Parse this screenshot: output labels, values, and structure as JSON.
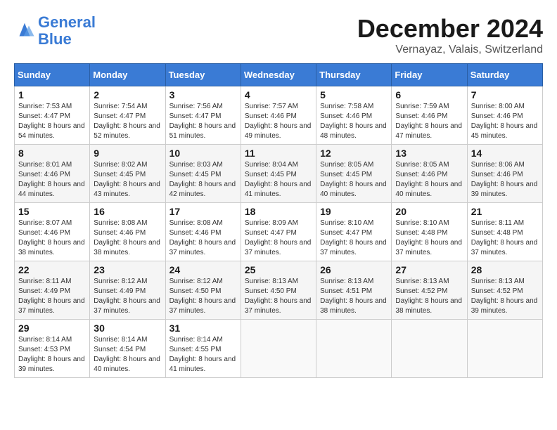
{
  "header": {
    "logo_line1": "General",
    "logo_line2": "Blue",
    "title": "December 2024",
    "subtitle": "Vernayaz, Valais, Switzerland"
  },
  "days_of_week": [
    "Sunday",
    "Monday",
    "Tuesday",
    "Wednesday",
    "Thursday",
    "Friday",
    "Saturday"
  ],
  "weeks": [
    [
      {
        "day": "1",
        "sunrise": "7:53 AM",
        "sunset": "4:47 PM",
        "daylight": "8 hours and 54 minutes."
      },
      {
        "day": "2",
        "sunrise": "7:54 AM",
        "sunset": "4:47 PM",
        "daylight": "8 hours and 52 minutes."
      },
      {
        "day": "3",
        "sunrise": "7:56 AM",
        "sunset": "4:47 PM",
        "daylight": "8 hours and 51 minutes."
      },
      {
        "day": "4",
        "sunrise": "7:57 AM",
        "sunset": "4:46 PM",
        "daylight": "8 hours and 49 minutes."
      },
      {
        "day": "5",
        "sunrise": "7:58 AM",
        "sunset": "4:46 PM",
        "daylight": "8 hours and 48 minutes."
      },
      {
        "day": "6",
        "sunrise": "7:59 AM",
        "sunset": "4:46 PM",
        "daylight": "8 hours and 47 minutes."
      },
      {
        "day": "7",
        "sunrise": "8:00 AM",
        "sunset": "4:46 PM",
        "daylight": "8 hours and 45 minutes."
      }
    ],
    [
      {
        "day": "8",
        "sunrise": "8:01 AM",
        "sunset": "4:46 PM",
        "daylight": "8 hours and 44 minutes."
      },
      {
        "day": "9",
        "sunrise": "8:02 AM",
        "sunset": "4:45 PM",
        "daylight": "8 hours and 43 minutes."
      },
      {
        "day": "10",
        "sunrise": "8:03 AM",
        "sunset": "4:45 PM",
        "daylight": "8 hours and 42 minutes."
      },
      {
        "day": "11",
        "sunrise": "8:04 AM",
        "sunset": "4:45 PM",
        "daylight": "8 hours and 41 minutes."
      },
      {
        "day": "12",
        "sunrise": "8:05 AM",
        "sunset": "4:45 PM",
        "daylight": "8 hours and 40 minutes."
      },
      {
        "day": "13",
        "sunrise": "8:05 AM",
        "sunset": "4:46 PM",
        "daylight": "8 hours and 40 minutes."
      },
      {
        "day": "14",
        "sunrise": "8:06 AM",
        "sunset": "4:46 PM",
        "daylight": "8 hours and 39 minutes."
      }
    ],
    [
      {
        "day": "15",
        "sunrise": "8:07 AM",
        "sunset": "4:46 PM",
        "daylight": "8 hours and 38 minutes."
      },
      {
        "day": "16",
        "sunrise": "8:08 AM",
        "sunset": "4:46 PM",
        "daylight": "8 hours and 38 minutes."
      },
      {
        "day": "17",
        "sunrise": "8:08 AM",
        "sunset": "4:46 PM",
        "daylight": "8 hours and 37 minutes."
      },
      {
        "day": "18",
        "sunrise": "8:09 AM",
        "sunset": "4:47 PM",
        "daylight": "8 hours and 37 minutes."
      },
      {
        "day": "19",
        "sunrise": "8:10 AM",
        "sunset": "4:47 PM",
        "daylight": "8 hours and 37 minutes."
      },
      {
        "day": "20",
        "sunrise": "8:10 AM",
        "sunset": "4:48 PM",
        "daylight": "8 hours and 37 minutes."
      },
      {
        "day": "21",
        "sunrise": "8:11 AM",
        "sunset": "4:48 PM",
        "daylight": "8 hours and 37 minutes."
      }
    ],
    [
      {
        "day": "22",
        "sunrise": "8:11 AM",
        "sunset": "4:49 PM",
        "daylight": "8 hours and 37 minutes."
      },
      {
        "day": "23",
        "sunrise": "8:12 AM",
        "sunset": "4:49 PM",
        "daylight": "8 hours and 37 minutes."
      },
      {
        "day": "24",
        "sunrise": "8:12 AM",
        "sunset": "4:50 PM",
        "daylight": "8 hours and 37 minutes."
      },
      {
        "day": "25",
        "sunrise": "8:13 AM",
        "sunset": "4:50 PM",
        "daylight": "8 hours and 37 minutes."
      },
      {
        "day": "26",
        "sunrise": "8:13 AM",
        "sunset": "4:51 PM",
        "daylight": "8 hours and 38 minutes."
      },
      {
        "day": "27",
        "sunrise": "8:13 AM",
        "sunset": "4:52 PM",
        "daylight": "8 hours and 38 minutes."
      },
      {
        "day": "28",
        "sunrise": "8:13 AM",
        "sunset": "4:52 PM",
        "daylight": "8 hours and 39 minutes."
      }
    ],
    [
      {
        "day": "29",
        "sunrise": "8:14 AM",
        "sunset": "4:53 PM",
        "daylight": "8 hours and 39 minutes."
      },
      {
        "day": "30",
        "sunrise": "8:14 AM",
        "sunset": "4:54 PM",
        "daylight": "8 hours and 40 minutes."
      },
      {
        "day": "31",
        "sunrise": "8:14 AM",
        "sunset": "4:55 PM",
        "daylight": "8 hours and 41 minutes."
      },
      null,
      null,
      null,
      null
    ]
  ]
}
